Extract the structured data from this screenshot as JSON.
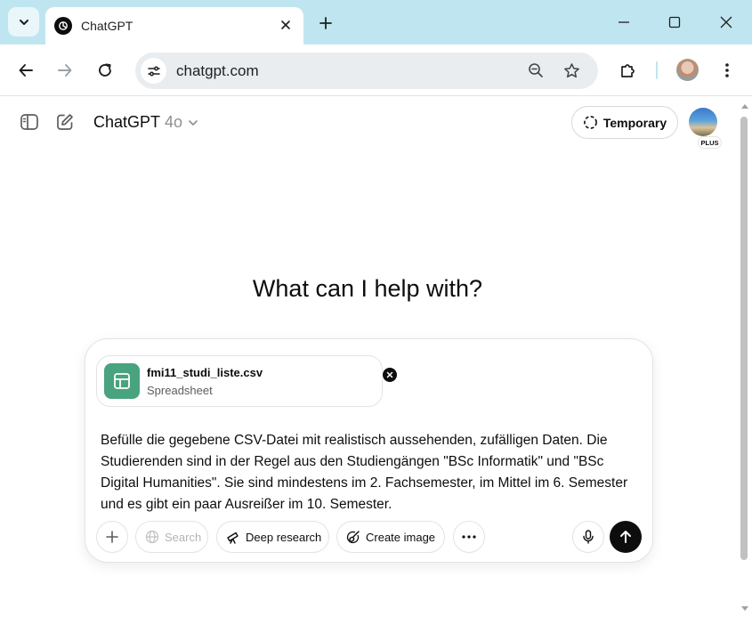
{
  "browser": {
    "tab": {
      "title": "ChatGPT",
      "favicon": "openai-logo-icon"
    },
    "url": "chatgpt.com",
    "icons": {
      "tab_search": "chevron-down-icon",
      "new_tab": "plus-icon",
      "back": "arrow-left-icon",
      "forward": "arrow-right-icon",
      "reload": "reload-icon",
      "zoom": "zoom-out-icon",
      "bookmark": "star-icon",
      "extensions": "puzzle-icon",
      "menu": "more-vertical-icon"
    }
  },
  "header": {
    "model_name": "ChatGPT",
    "model_version": "4o",
    "temporary_label": "Temporary",
    "plan_badge": "PLUS"
  },
  "main": {
    "headline": "What can I help with?"
  },
  "composer": {
    "attachment": {
      "file_name": "fmi11_studi_liste.csv",
      "file_type": "Spreadsheet"
    },
    "prompt_text": "Befülle die gegebene CSV-Datei mit realistisch aussehenden, zufälligen Daten. Die Studierenden sind in der Regel aus den Studiengängen \"BSc Informatik\" und \"BSc Digital Humanities\". Sie sind mindestens im 2. Fachsemester, im Mittel im 6. Semester und es gibt ein paar Ausreißer im 10. Semester.",
    "tools": {
      "search_label": "Search",
      "deep_research_label": "Deep research",
      "create_image_label": "Create image"
    }
  },
  "colors": {
    "tabbar": "#bfe6f0",
    "spreadsheet_icon": "#49a37f",
    "send_button": "#0d0d0d"
  }
}
